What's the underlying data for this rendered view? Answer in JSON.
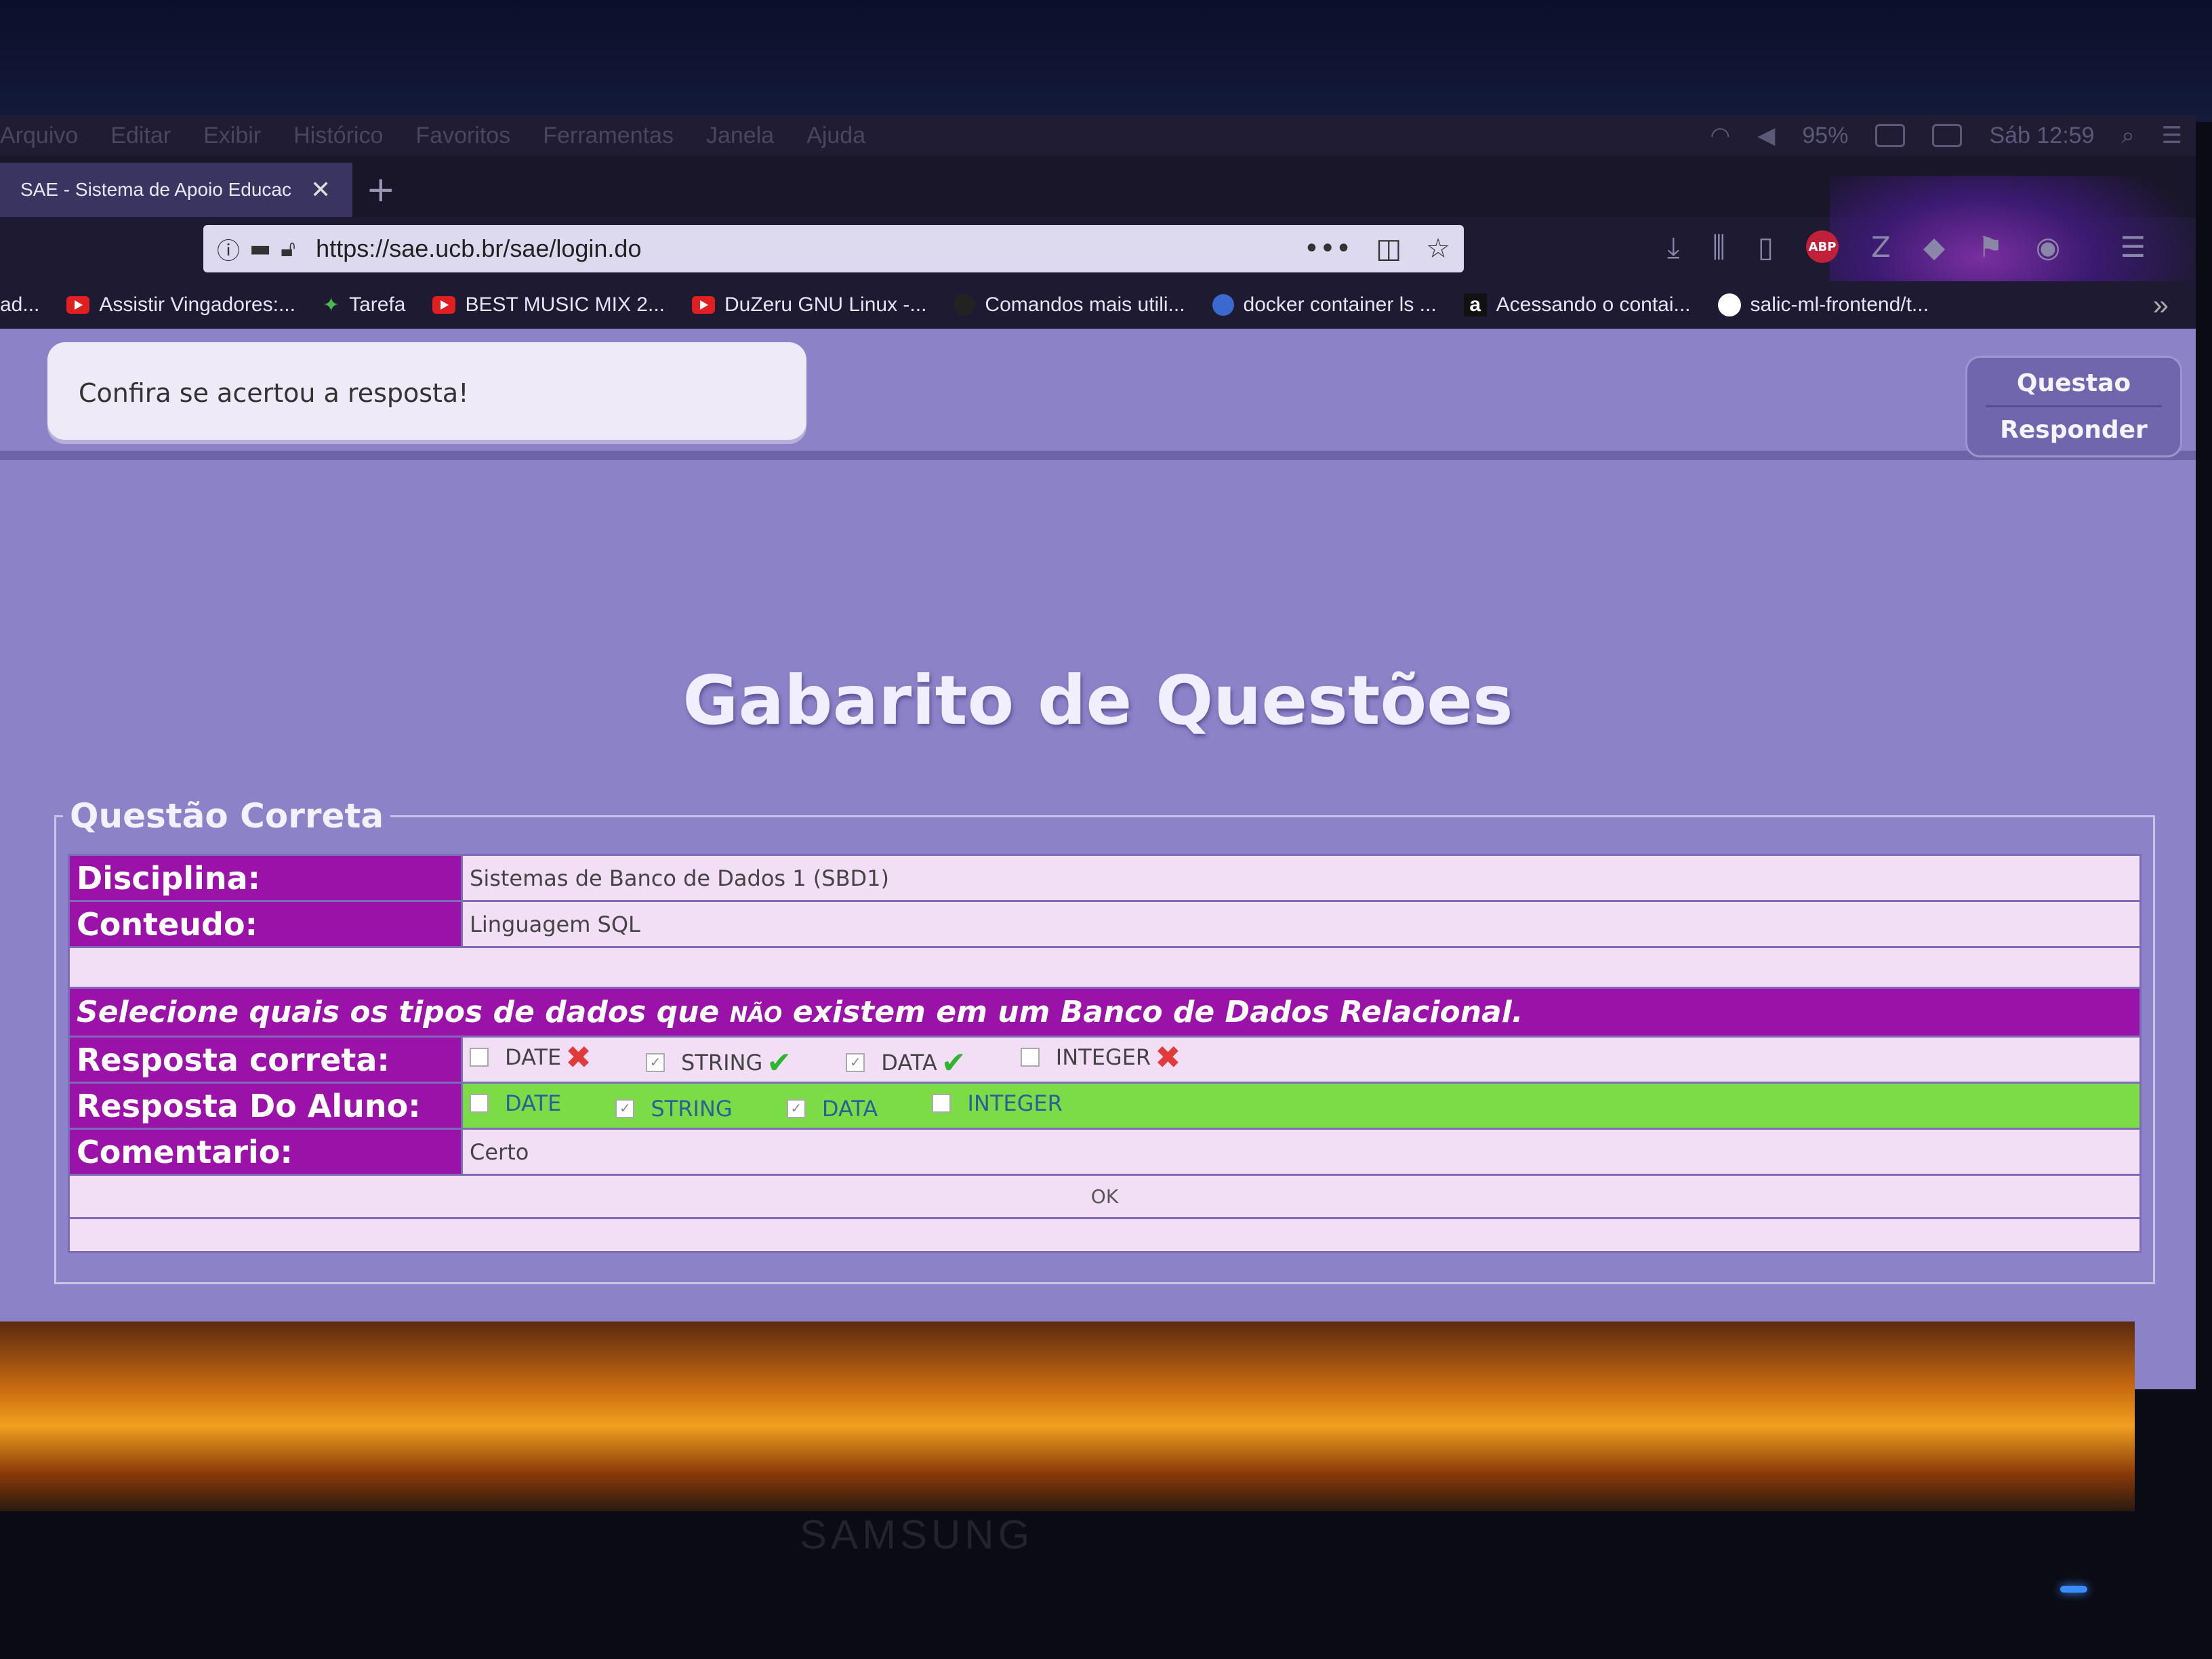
{
  "menubar": {
    "items": [
      "Arquivo",
      "Editar",
      "Exibir",
      "Histórico",
      "Favoritos",
      "Ferramentas",
      "Janela",
      "Ajuda"
    ],
    "battery": "95%",
    "clock": "Sáb 12:59"
  },
  "tab": {
    "title": "SAE - Sistema de Apoio Educac",
    "close": "✕",
    "new_tab": "+"
  },
  "urlbar": {
    "url": "https://sae.ucb.br/sae/login.do",
    "more": "•••"
  },
  "toolbar": {
    "abp": "ABP",
    "z": "Z"
  },
  "bookmarks": [
    {
      "label": "ad...",
      "icon": "none"
    },
    {
      "label": "Assistir Vingadores:...",
      "icon": "play-icon"
    },
    {
      "label": "Tarefa",
      "icon": "leaf-icon"
    },
    {
      "label": "BEST MUSIC MIX 2...",
      "icon": "youtube-icon"
    },
    {
      "label": "DuZeru GNU Linux -...",
      "icon": "youtube-icon"
    },
    {
      "label": "Comandos mais utili...",
      "icon": "dot-icon"
    },
    {
      "label": "docker container ls ...",
      "icon": "globe-icon"
    },
    {
      "label": "Acessando o contai...",
      "icon": "a-icon"
    },
    {
      "label": "salic-ml-frontend/t...",
      "icon": "github-icon"
    }
  ],
  "page": {
    "message": "Confira se acertou a resposta!",
    "buttons": {
      "questao": "Questao",
      "responder": "Responder"
    },
    "title": "Gabarito de Questões",
    "legend": "Questão Correta",
    "disciplina_label": "Disciplina:",
    "disciplina_value": "Sistemas de Banco de Dados 1 (SBD1)",
    "conteudo_label": "Conteudo:",
    "conteudo_value": "Linguagem SQL",
    "question_part1": "Selecione quais os tipos de dados que",
    "question_nao": "NÃO",
    "question_part2": "existem em um Banco de Dados Relacional.",
    "resposta_correta_label": "Resposta correta:",
    "resposta_aluno_label": "Resposta Do Aluno:",
    "comentario_label": "Comentario:",
    "comentario_value": "Certo",
    "ok_label": "OK",
    "options": [
      "DATE",
      "STRING",
      "DATA",
      "INTEGER"
    ],
    "correct_checked": [
      false,
      true,
      true,
      false
    ],
    "student_checked": [
      false,
      true,
      true,
      false
    ]
  },
  "monitor_brand": "SAMSUNG",
  "colors": {
    "label_bg": "#9b12a8",
    "page_bg": "#8c82c8",
    "student_row": "#7cdc46",
    "cell_bg": "#f3dff5"
  }
}
